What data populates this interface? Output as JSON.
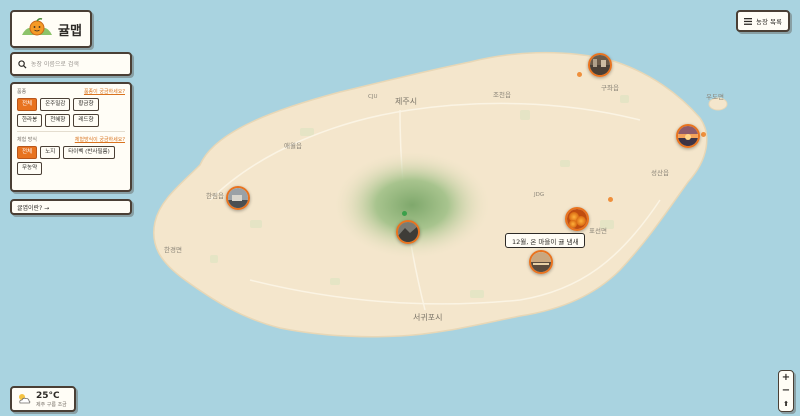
{
  "app": {
    "title": "귤맵"
  },
  "search": {
    "placeholder": "농장 이름으로 검색"
  },
  "filters": {
    "varieties": {
      "label": "품종",
      "help_link": "품종이 궁금하세요?",
      "options": [
        "전체",
        "온주밀감",
        "황금향",
        "한라봉",
        "천혜향",
        "레드향"
      ],
      "selected": "전체"
    },
    "experience": {
      "label": "체험 방식",
      "help_link": "체험방식이 궁금하세요?",
      "options": [
        "전체",
        "노지",
        "타이벡 (반사필름)",
        "무농약"
      ],
      "selected": "전체"
    }
  },
  "whatis": {
    "label": "귤엽이란? →"
  },
  "farm_list_button": {
    "label": "농장 목록",
    "icon": "menu-icon"
  },
  "weather": {
    "temperature": "25°C",
    "description": "제주 구름 조금",
    "icon": "partly-cloudy-icon"
  },
  "zoom": {
    "in": "+",
    "out": "−",
    "compass": "⬆"
  },
  "map_labels": {
    "jeju_city": "제주시",
    "cju": "CJU",
    "jocheon": "조천읍",
    "gujwa": "구좌읍",
    "udo": "우도면",
    "aewol": "애월읍",
    "hallim": "한림읍",
    "hangyeong": "한경면",
    "jdg": "JDG",
    "seongsan": "성산읍",
    "pyoseon": "표선면",
    "seogwipo": "서귀포시"
  },
  "callout": {
    "text": "12월, 온 마을이 귤 냄새"
  },
  "markers": [
    {
      "name": "gujwa-farm-photo",
      "icon": "dock-photo"
    },
    {
      "name": "seongsan-sunrise-photo",
      "icon": "sunrise-photo"
    },
    {
      "name": "hallim-village-photo",
      "icon": "village-photo"
    },
    {
      "name": "hallasan-photo",
      "icon": "mountain-photo"
    },
    {
      "name": "tangerine-photo",
      "icon": "tangerine-photo"
    },
    {
      "name": "namwon-sunset-photo",
      "icon": "sunset-photo"
    }
  ],
  "colors": {
    "accent": "#e8731f",
    "sea": "#a9d3e0",
    "land": "#f4e6cc",
    "mountain": "#9fbe86",
    "ink": "#2d2a26"
  }
}
